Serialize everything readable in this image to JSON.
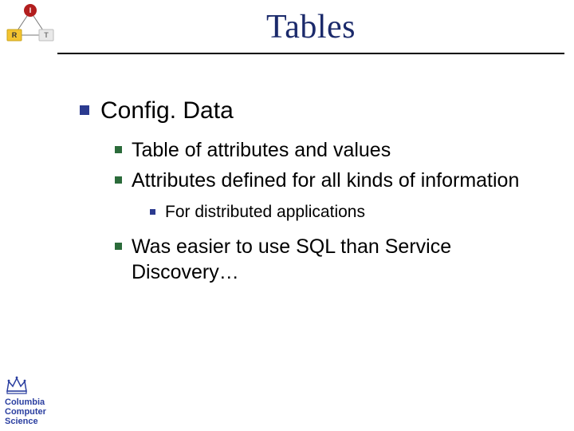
{
  "title": "Tables",
  "bullets": {
    "l1": {
      "text": "Config. Data"
    },
    "l2a": {
      "text": "Table of attributes and values"
    },
    "l2b": {
      "text": "Attributes defined for all kinds of information"
    },
    "l3a": {
      "text": "For distributed applications"
    },
    "l2c": {
      "text": "Was easier to use SQL than Service Discovery…"
    }
  },
  "footer": {
    "line1": "Columbia",
    "line2": "Computer",
    "line3": "Science"
  },
  "logo": {
    "top": {
      "label": "I"
    },
    "left": {
      "label": "R"
    },
    "right": {
      "label": "T"
    }
  },
  "colors": {
    "title": "#1b2a6b",
    "bullet_l1": "#2b3a8f",
    "bullet_l2": "#2b6b3a",
    "bullet_l3": "#2b3a8f",
    "footer": "#2b3fa0"
  }
}
